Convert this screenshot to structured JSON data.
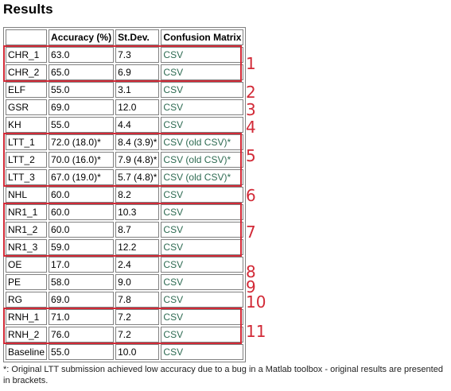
{
  "page_title": "Results",
  "table": {
    "headers": [
      "",
      "Accuracy (%)",
      "St.Dev.",
      "Confusion Matrix"
    ],
    "rows": [
      [
        "CHR_1",
        "63.0",
        "7.3",
        "CSV"
      ],
      [
        "CHR_2",
        "65.0",
        "6.9",
        "CSV"
      ],
      [
        "ELF",
        "55.0",
        "3.1",
        "CSV"
      ],
      [
        "GSR",
        "69.0",
        "12.0",
        "CSV"
      ],
      [
        "KH",
        "55.0",
        "4.4",
        "CSV"
      ],
      [
        "LTT_1",
        "72.0 (18.0)*",
        "8.4 (3.9)*",
        "CSV (old CSV)*"
      ],
      [
        "LTT_2",
        "70.0 (16.0)*",
        "7.9 (4.8)*",
        "CSV (old CSV)*"
      ],
      [
        "LTT_3",
        "67.0 (19.0)*",
        "5.7 (4.8)*",
        "CSV (old CSV)*"
      ],
      [
        "NHL",
        "60.0",
        "8.2",
        "CSV"
      ],
      [
        "NR1_1",
        "60.0",
        "10.3",
        "CSV"
      ],
      [
        "NR1_2",
        "60.0",
        "8.7",
        "CSV"
      ],
      [
        "NR1_3",
        "59.0",
        "12.2",
        "CSV"
      ],
      [
        "OE",
        "17.0",
        "2.4",
        "CSV"
      ],
      [
        "PE",
        "58.0",
        "9.0",
        "CSV"
      ],
      [
        "RG",
        "69.0",
        "7.8",
        "CSV"
      ],
      [
        "RNH_1",
        "71.0",
        "7.2",
        "CSV"
      ],
      [
        "RNH_2",
        "76.0",
        "7.2",
        "CSV"
      ],
      [
        "Baseline",
        "55.0",
        "10.0",
        "CSV"
      ]
    ]
  },
  "annotations": [
    "1",
    "2",
    "3",
    "4",
    "5",
    "6",
    "7",
    "8",
    "9",
    "10",
    "11"
  ],
  "annotation_color": "#d22a37",
  "link_color": "#2e6b52",
  "footnote": "*: Original LTT submission achieved low accuracy due to a bug in a Matlab toolbox - original results are presented in brackets."
}
